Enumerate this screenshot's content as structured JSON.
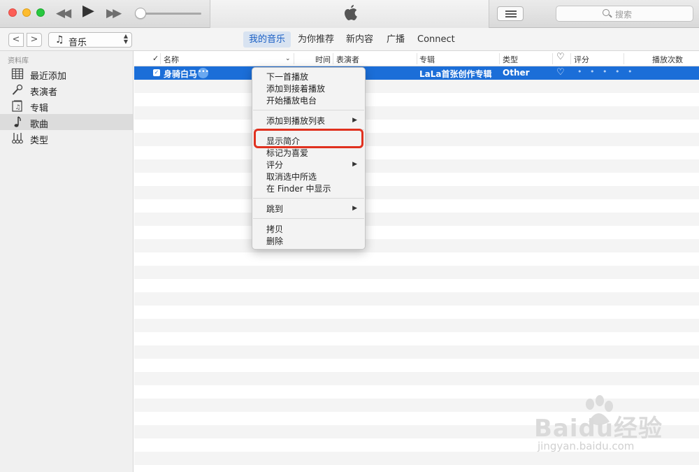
{
  "search": {
    "placeholder": "搜索"
  },
  "toolbar": {
    "back": "<",
    "forward": ">",
    "media_label": "音乐",
    "tabs": [
      "我的音乐",
      "为你推荐",
      "新内容",
      "广播",
      "Connect"
    ]
  },
  "sidebar": {
    "heading": "资料库",
    "items": [
      {
        "label": "最近添加",
        "icon": "grid-icon"
      },
      {
        "label": "表演者",
        "icon": "microphone-icon"
      },
      {
        "label": "专辑",
        "icon": "album-icon"
      },
      {
        "label": "歌曲",
        "icon": "music-note-icon",
        "selected": true
      },
      {
        "label": "类型",
        "icon": "instruments-icon"
      }
    ]
  },
  "table": {
    "columns": {
      "check": "✓",
      "name": "名称",
      "time": "时间",
      "artist": "表演者",
      "album": "专辑",
      "genre": "类型",
      "rating": "评分",
      "plays": "播放次数"
    },
    "song": {
      "name": "身骑白马",
      "album": "LaLa首张创作专辑",
      "genre": "Other",
      "more": "•••",
      "check": "✓",
      "rating": "• • • • •"
    }
  },
  "context_menu": {
    "items": [
      "下一首播放",
      "添加到接着播放",
      "开始播放电台",
      "添加到播放列表",
      "显示简介",
      "标记为喜爱",
      "评分",
      "取消选中所选",
      "在 Finder 中显示",
      "跳到",
      "拷贝",
      "删除"
    ],
    "highlighted": "显示简介"
  },
  "watermark": {
    "brand": "Baidu经验",
    "url": "jingyan.baidu.com"
  },
  "colors": {
    "selection": "#1b6ed8",
    "highlight_border": "#e0311f",
    "tab_active": "#1a5fc4"
  }
}
